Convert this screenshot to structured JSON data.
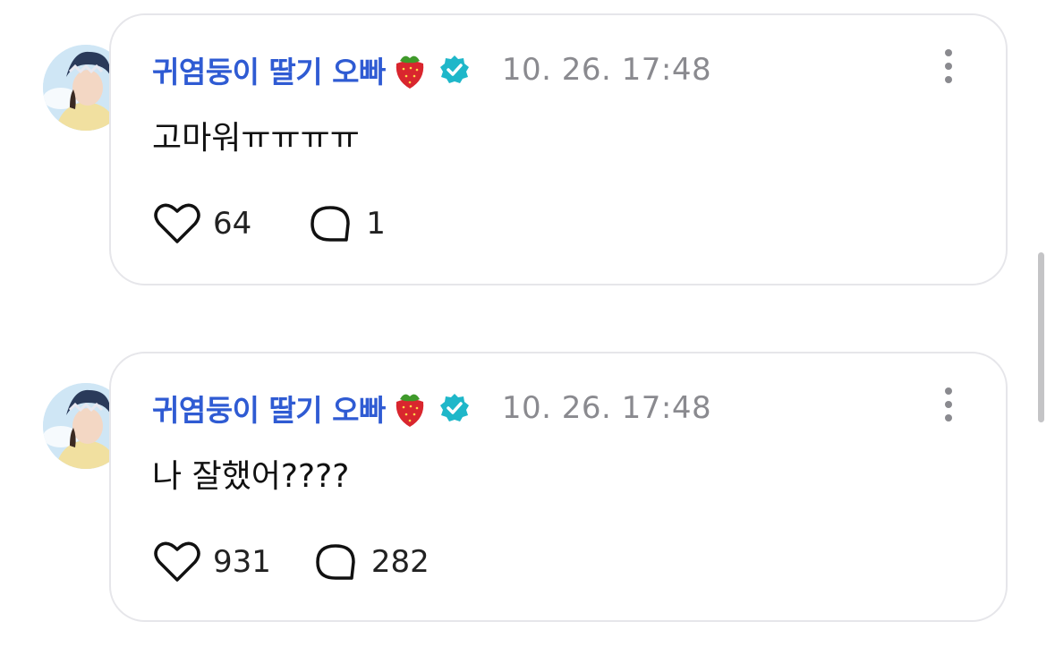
{
  "posts": [
    {
      "author": "귀염둥이 딸기 오빠",
      "author_emoji": "strawberry-icon",
      "verified": true,
      "timestamp": "10. 26. 17:48",
      "text": "고마워ㅠㅠㅠㅠ",
      "likes": "64",
      "replies": "1"
    },
    {
      "author": "귀염둥이 딸기 오빠",
      "author_emoji": "strawberry-icon",
      "verified": true,
      "timestamp": "10. 26. 17:48",
      "text": "나 잘했어????",
      "likes": "931",
      "replies": "282"
    }
  ],
  "colors": {
    "author": "#2f5bd3",
    "badge": "#1fb7c9",
    "timestamp": "#8a8a8f",
    "card_border": "#e6e6ea"
  }
}
